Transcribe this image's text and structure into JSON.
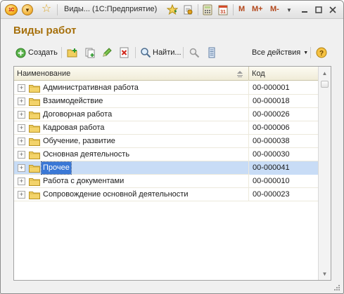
{
  "titlebar": {
    "logo_text": "1С",
    "title": "Виды...  (1С:Предприятие)",
    "m_labels": [
      "M",
      "M+",
      "M-"
    ]
  },
  "form": {
    "title": "Виды работ"
  },
  "toolbar": {
    "create_label": "Создать",
    "find_label": "Найти...",
    "all_actions_label": "Все действия"
  },
  "table": {
    "columns": [
      "Наименование",
      "Код"
    ],
    "rows": [
      {
        "name": "Административная работа",
        "code": "00-000001"
      },
      {
        "name": "Взаимодействие",
        "code": "00-000018"
      },
      {
        "name": "Договорная работа",
        "code": "00-000026"
      },
      {
        "name": "Кадровая работа",
        "code": "00-000006"
      },
      {
        "name": "Обучение, развитие",
        "code": "00-000038"
      },
      {
        "name": "Основная деятельность",
        "code": "00-000030"
      },
      {
        "name": "Прочее",
        "code": "00-000041",
        "selected": true
      },
      {
        "name": "Работа с документами",
        "code": "00-000010"
      },
      {
        "name": "Сопровождение основной деятельности",
        "code": "00-000023"
      }
    ]
  },
  "colors": {
    "accent_title": "#a6700c",
    "selection_text_bg": "#3a78d6",
    "selection_row_bg": "#c8dcf6"
  }
}
